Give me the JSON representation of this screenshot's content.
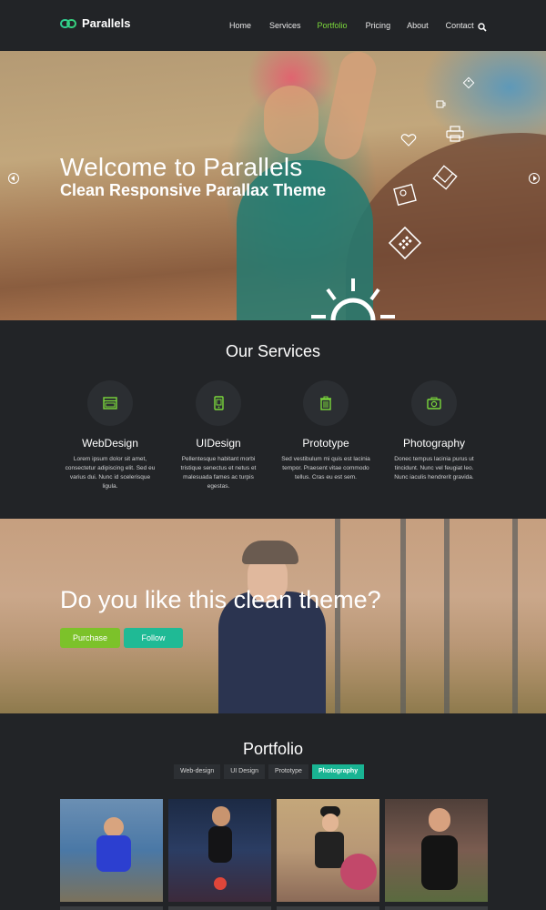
{
  "brand": {
    "name": "Parallels"
  },
  "nav": {
    "items": [
      "Home",
      "Services",
      "Portfolio",
      "Pricing",
      "About",
      "Contact"
    ],
    "active": "Portfolio"
  },
  "hero": {
    "title": "Welcome to Parallels",
    "subtitle": "Clean Responsive Parallax Theme"
  },
  "services": {
    "title": "Our Services",
    "items": [
      {
        "title": "WebDesign",
        "icon": "browser-window-icon",
        "desc": "Lorem ipsum dolor sit amet, consectetur adipiscing elit. Sed eu varius dui. Nunc id scelerisque ligula."
      },
      {
        "title": "UIDesign",
        "icon": "mobile-phone-icon",
        "desc": "Pellentesque habitant morbi tristique senectus et netus et malesuada fames ac turpis egestas."
      },
      {
        "title": "Prototype",
        "icon": "trash-bin-icon",
        "desc": "Sed vestibulum mi quis est lacinia tempor. Praesent vitae commodo tellus. Cras eu est sem."
      },
      {
        "title": "Photography",
        "icon": "camera-icon",
        "desc": "Donec tempus lacinia purus ut tincidunt. Nunc vel feugiat leo. Nunc iaculis hendrerit gravida."
      }
    ]
  },
  "cta": {
    "title": "Do you like this clean theme?",
    "purchase_label": "Purchase",
    "follow_label": "Follow"
  },
  "portfolio": {
    "title": "Portfolio",
    "filters": [
      "Web-design",
      "UI Design",
      "Prototype",
      "Photography"
    ],
    "active_filter": "Photography"
  },
  "colors": {
    "accent_green": "#7bd83b",
    "teal": "#1fba95",
    "dark_bg": "#222427"
  }
}
